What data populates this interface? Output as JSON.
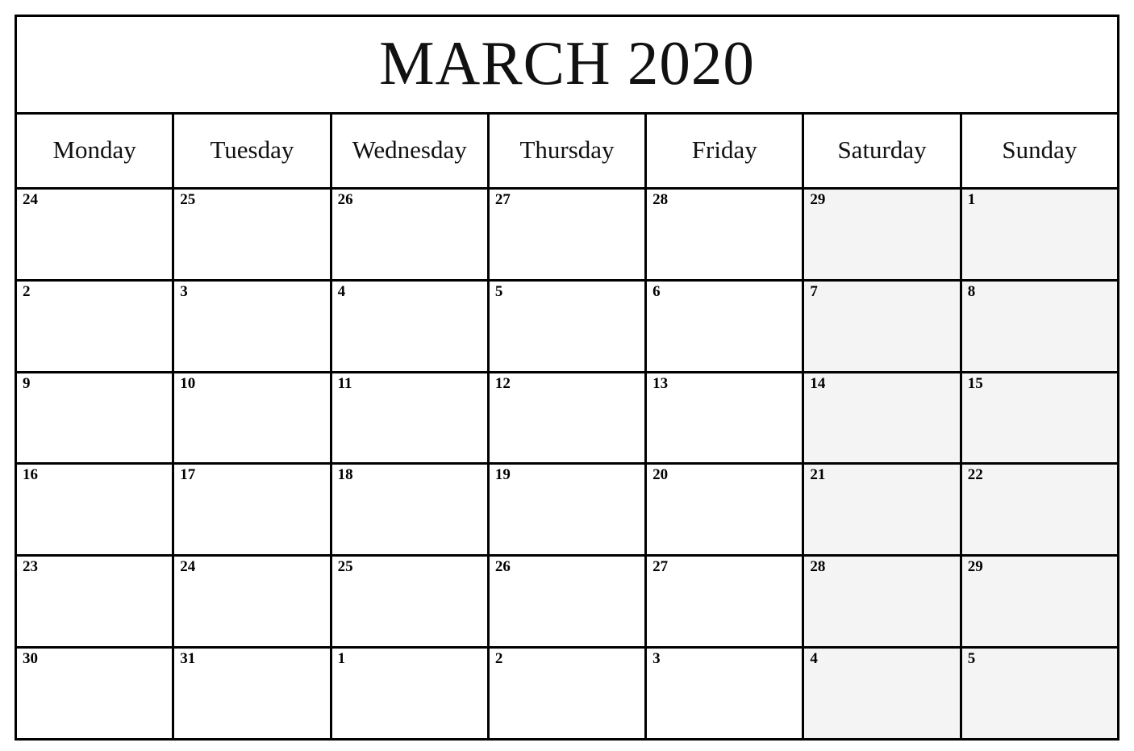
{
  "calendar": {
    "title": "MARCH 2020",
    "month": "March",
    "year": "2020",
    "week_start": "Monday",
    "weekend_shading_color": "#f4f4f4",
    "border_color": "#000000",
    "page_background": "#ffffff",
    "weekdays": [
      {
        "label": "Monday",
        "is_weekend": false
      },
      {
        "label": "Tuesday",
        "is_weekend": false
      },
      {
        "label": "Wednesday",
        "is_weekend": false
      },
      {
        "label": "Thursday",
        "is_weekend": false
      },
      {
        "label": "Friday",
        "is_weekend": false
      },
      {
        "label": "Saturday",
        "is_weekend": true
      },
      {
        "label": "Sunday",
        "is_weekend": true
      }
    ],
    "weeks": [
      {
        "days": [
          {
            "number": "24",
            "in_month": false,
            "weekend": false,
            "events": ""
          },
          {
            "number": "25",
            "in_month": false,
            "weekend": false,
            "events": ""
          },
          {
            "number": "26",
            "in_month": false,
            "weekend": false,
            "events": ""
          },
          {
            "number": "27",
            "in_month": false,
            "weekend": false,
            "events": ""
          },
          {
            "number": "28",
            "in_month": false,
            "weekend": false,
            "events": ""
          },
          {
            "number": "29",
            "in_month": false,
            "weekend": true,
            "events": ""
          },
          {
            "number": "1",
            "in_month": true,
            "weekend": true,
            "events": ""
          }
        ]
      },
      {
        "days": [
          {
            "number": "2",
            "in_month": true,
            "weekend": false,
            "events": ""
          },
          {
            "number": "3",
            "in_month": true,
            "weekend": false,
            "events": ""
          },
          {
            "number": "4",
            "in_month": true,
            "weekend": false,
            "events": ""
          },
          {
            "number": "5",
            "in_month": true,
            "weekend": false,
            "events": ""
          },
          {
            "number": "6",
            "in_month": true,
            "weekend": false,
            "events": ""
          },
          {
            "number": "7",
            "in_month": true,
            "weekend": true,
            "events": ""
          },
          {
            "number": "8",
            "in_month": true,
            "weekend": true,
            "events": ""
          }
        ]
      },
      {
        "days": [
          {
            "number": "9",
            "in_month": true,
            "weekend": false,
            "events": ""
          },
          {
            "number": "10",
            "in_month": true,
            "weekend": false,
            "events": ""
          },
          {
            "number": "11",
            "in_month": true,
            "weekend": false,
            "events": ""
          },
          {
            "number": "12",
            "in_month": true,
            "weekend": false,
            "events": ""
          },
          {
            "number": "13",
            "in_month": true,
            "weekend": false,
            "events": ""
          },
          {
            "number": "14",
            "in_month": true,
            "weekend": true,
            "events": ""
          },
          {
            "number": "15",
            "in_month": true,
            "weekend": true,
            "events": ""
          }
        ]
      },
      {
        "days": [
          {
            "number": "16",
            "in_month": true,
            "weekend": false,
            "events": ""
          },
          {
            "number": "17",
            "in_month": true,
            "weekend": false,
            "events": ""
          },
          {
            "number": "18",
            "in_month": true,
            "weekend": false,
            "events": ""
          },
          {
            "number": "19",
            "in_month": true,
            "weekend": false,
            "events": ""
          },
          {
            "number": "20",
            "in_month": true,
            "weekend": false,
            "events": ""
          },
          {
            "number": "21",
            "in_month": true,
            "weekend": true,
            "events": ""
          },
          {
            "number": "22",
            "in_month": true,
            "weekend": true,
            "events": ""
          }
        ]
      },
      {
        "days": [
          {
            "number": "23",
            "in_month": true,
            "weekend": false,
            "events": ""
          },
          {
            "number": "24",
            "in_month": true,
            "weekend": false,
            "events": ""
          },
          {
            "number": "25",
            "in_month": true,
            "weekend": false,
            "events": ""
          },
          {
            "number": "26",
            "in_month": true,
            "weekend": false,
            "events": ""
          },
          {
            "number": "27",
            "in_month": true,
            "weekend": false,
            "events": ""
          },
          {
            "number": "28",
            "in_month": true,
            "weekend": true,
            "events": ""
          },
          {
            "number": "29",
            "in_month": true,
            "weekend": true,
            "events": ""
          }
        ]
      },
      {
        "days": [
          {
            "number": "30",
            "in_month": true,
            "weekend": false,
            "events": ""
          },
          {
            "number": "31",
            "in_month": true,
            "weekend": false,
            "events": ""
          },
          {
            "number": "1",
            "in_month": false,
            "weekend": false,
            "events": ""
          },
          {
            "number": "2",
            "in_month": false,
            "weekend": false,
            "events": ""
          },
          {
            "number": "3",
            "in_month": false,
            "weekend": false,
            "events": ""
          },
          {
            "number": "4",
            "in_month": false,
            "weekend": true,
            "events": ""
          },
          {
            "number": "5",
            "in_month": false,
            "weekend": true,
            "events": ""
          }
        ]
      }
    ]
  }
}
